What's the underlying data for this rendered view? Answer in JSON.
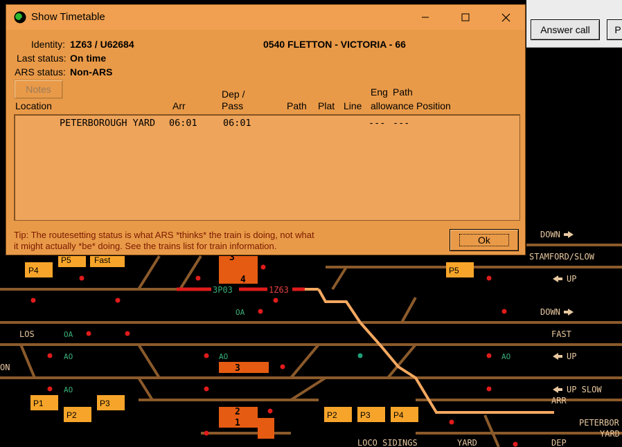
{
  "dialog": {
    "title": "Show Timetable",
    "identity_label": "Identity:",
    "identity_value": "1Z63 / U62684",
    "service": "0540 FLETTON - VICTORIA - 66",
    "last_status_label": "Last status:",
    "last_status_value": "On time",
    "ars_status_label": "ARS status:",
    "ars_status_value": "Non-ARS",
    "notes_label": "Notes",
    "columns": {
      "location": "Location",
      "arr": "Arr",
      "dep1": "Dep /",
      "dep2": "Pass",
      "path": "Path",
      "plat": "Plat",
      "line": "Line",
      "eng1": "Eng",
      "eng2": "allowance",
      "pathpos1": "Path",
      "pathpos2": "Position"
    },
    "rows": [
      {
        "location": "PETERBOROUGH YARD",
        "arr": "06:01",
        "dep": "06:01",
        "eng": "---",
        "pathpos": "---"
      }
    ],
    "tip_line1": "Tip: The routesetting status is what ARS *thinks* the train is doing, not what",
    "tip_line2": "it might actually *be* doing. See the trains list for train information.",
    "ok_label": "Ok"
  },
  "toolbar": {
    "answer_call": "Answer call",
    "partial": "P"
  },
  "diagram": {
    "labels": {
      "down1": "DOWN",
      "stamford_slow": "STAMFORD/SLOW",
      "up1": "UP",
      "down2": "DOWN",
      "fast": "FAST",
      "up2": "UP",
      "up_slow": "UP SLOW",
      "arr": "ARR",
      "dep": "DEP",
      "peterborough": "PETERBOR",
      "yard": "YARD",
      "loco_sidings": "LOCO SIDINGS",
      "yard2": "YARD",
      "los": "LOS",
      "on": "ON"
    },
    "platforms": [
      "P4",
      "P5",
      "Fast",
      "P5",
      "P1",
      "P2",
      "P3",
      "P2",
      "P3",
      "P4"
    ],
    "berths": [
      "4",
      "3",
      "2",
      "1",
      "3"
    ],
    "headcodes": [
      "3P03",
      "1Z63"
    ],
    "signal_ids": [
      "AO",
      "AO",
      "AO",
      "OA",
      "OA",
      "AO"
    ],
    "colors": {
      "track": "#8b5a2b",
      "route_set": "#e11b1b",
      "platform": "#f7a52a",
      "occupied": "#e55b12",
      "dialog_bg": "#e99a48"
    }
  }
}
